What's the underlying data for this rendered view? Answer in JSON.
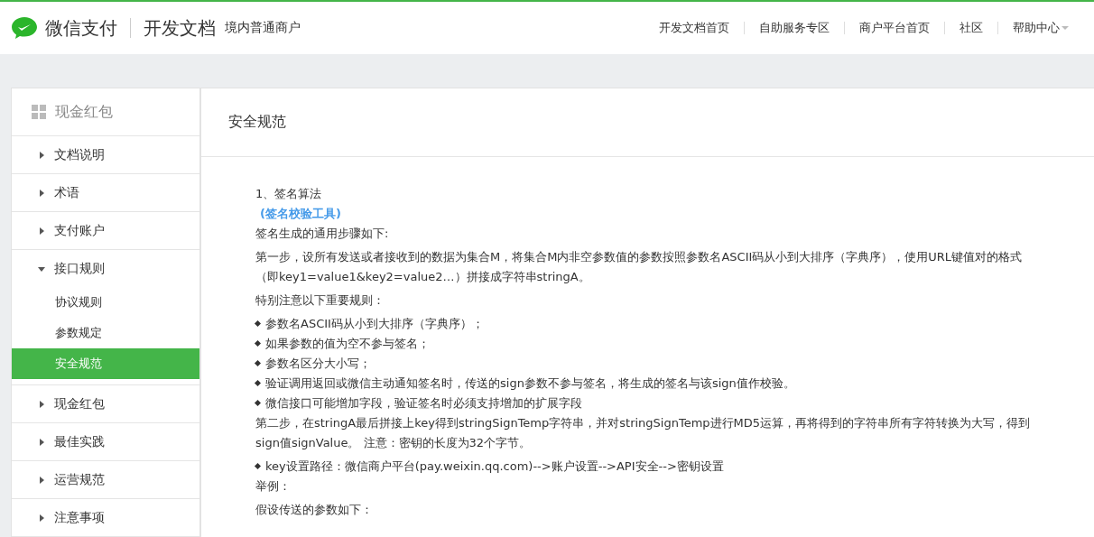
{
  "header": {
    "brand": "微信支付",
    "product": "开发文档",
    "subtitle": "境内普通商户",
    "nav": [
      {
        "label": "开发文档首页",
        "dropdown": false
      },
      {
        "label": "自助服务专区",
        "dropdown": false
      },
      {
        "label": "商户平台首页",
        "dropdown": false
      },
      {
        "label": "社区",
        "dropdown": false
      },
      {
        "label": "帮助中心",
        "dropdown": true
      }
    ]
  },
  "sidebar": {
    "title": "现金红包",
    "items": [
      {
        "label": "文档说明",
        "expanded": false
      },
      {
        "label": "术语",
        "expanded": false
      },
      {
        "label": "支付账户",
        "expanded": false
      },
      {
        "label": "接口规则",
        "expanded": true,
        "children": [
          {
            "label": "协议规则",
            "selected": false
          },
          {
            "label": "参数规定",
            "selected": false
          },
          {
            "label": "安全规范",
            "selected": true
          }
        ]
      },
      {
        "label": "现金红包",
        "expanded": false
      },
      {
        "label": "最佳实践",
        "expanded": false
      },
      {
        "label": "运营规范",
        "expanded": false
      },
      {
        "label": "注意事项",
        "expanded": false
      }
    ]
  },
  "content": {
    "title": "安全规范",
    "blocks": [
      {
        "kind": "heading",
        "text": "1、签名算法"
      },
      {
        "kind": "link",
        "text": "(签名校验工具)"
      },
      {
        "kind": "para",
        "text": "签名生成的通用步骤如下:"
      },
      {
        "kind": "para",
        "text": "第一步，设所有发送或者接收到的数据为集合M，将集合M内非空参数值的参数按照参数名ASCII码从小到大排序（字典序），使用URL键值对的格式（即key1=value1&key2=value2…）拼接成字符串stringA。"
      },
      {
        "kind": "para",
        "text": "特别注意以下重要规则："
      },
      {
        "kind": "bullet",
        "text": "参数名ASCII码从小到大排序（字典序）；"
      },
      {
        "kind": "bullet",
        "text": "如果参数的值为空不参与签名；"
      },
      {
        "kind": "bullet",
        "text": "参数名区分大小写；"
      },
      {
        "kind": "bullet",
        "text": "验证调用返回或微信主动通知签名时，传送的sign参数不参与签名，将生成的签名与该sign值作校验。"
      },
      {
        "kind": "bullet",
        "text": "微信接口可能增加字段，验证签名时必须支持增加的扩展字段"
      },
      {
        "kind": "para",
        "text": "第二步，在stringA最后拼接上key得到stringSignTemp字符串，并对stringSignTemp进行MD5运算，再将得到的字符串所有字符转换为大写，得到sign值signValue。 注意：密钥的长度为32个字节。"
      },
      {
        "kind": "bullet",
        "text": "key设置路径：微信商户平台(pay.weixin.qq.com)-->账户设置-->API安全-->密钥设置"
      },
      {
        "kind": "para",
        "text": "举例："
      },
      {
        "kind": "para",
        "text": "假设传送的参数如下："
      }
    ]
  }
}
